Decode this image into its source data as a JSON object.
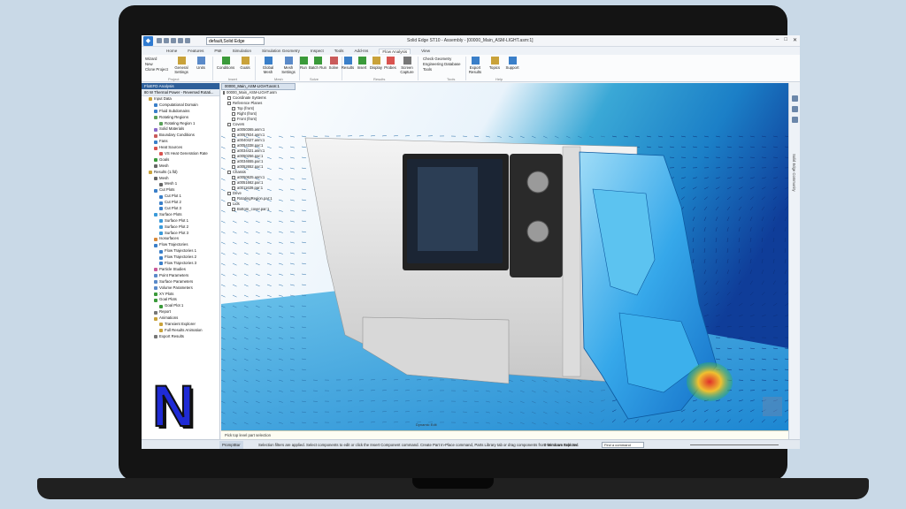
{
  "titlebar": {
    "environment": "default,Solid Edge",
    "window_title": "Solid Edge ST10 - Assembly - [00000_Main_ASM-LIGHT.asm:1]"
  },
  "tabs": [
    "Home",
    "Features",
    "PMI",
    "Simulation",
    "Simulation Geometry",
    "Inspect",
    "Tools",
    "Add-Ins",
    "Flow Analysis",
    "View"
  ],
  "ribbon": {
    "project": {
      "wizard": "Wizard",
      "new": "New",
      "clone": "Clone Project",
      "general": "General Settings",
      "units": "Units",
      "group": "Project"
    },
    "insert": {
      "conditions": "Conditions",
      "goals": "Goals",
      "group": "Insert"
    },
    "mesh": {
      "global": "Global Mesh",
      "settings": "Mesh Settings",
      "group": "Mesh"
    },
    "solve": {
      "run": "Run",
      "batch": "Batch Run",
      "solve": "Solve",
      "group": "Solve"
    },
    "results": {
      "results": "Results",
      "insert": "Insert",
      "display": "Display",
      "probes": "Probes",
      "capture": "Screen Capture",
      "group": "Results"
    },
    "tools": {
      "check": "Check Geometry",
      "db": "Engineering Database",
      "tools": "Tools",
      "group": "Tools"
    },
    "export": {
      "export": "Export Results",
      "topics": "Topics",
      "support": "Support",
      "group": "Help"
    }
  },
  "left_panel": {
    "header": "FloEFD Analysis",
    "project": "80 W Thermal Power - Reversed Rotati...",
    "tree": [
      {
        "label": "Input Data",
        "indent": 1,
        "color": "#c9a23a"
      },
      {
        "label": "Computational Domain",
        "indent": 2,
        "color": "#3a7fc9"
      },
      {
        "label": "Fluid Subdomains",
        "indent": 2,
        "color": "#3a7fc9"
      },
      {
        "label": "Rotating Regions",
        "indent": 2,
        "color": "#5aa05a"
      },
      {
        "label": "Rotating Region 1",
        "indent": 3,
        "color": "#5aa05a"
      },
      {
        "label": "Solid Materials",
        "indent": 2,
        "color": "#8a6ac9"
      },
      {
        "label": "Boundary Conditions",
        "indent": 2,
        "color": "#c95a5a"
      },
      {
        "label": "Fans",
        "indent": 2,
        "color": "#3a7fc9"
      },
      {
        "label": "Heat Sources",
        "indent": 2,
        "color": "#d9534f"
      },
      {
        "label": "VS Heat Generation Rate",
        "indent": 3,
        "color": "#d9534f"
      },
      {
        "label": "Goals",
        "indent": 2,
        "color": "#3a9a3a"
      },
      {
        "label": "Mesh",
        "indent": 2,
        "color": "#666666"
      },
      {
        "label": "Results (1.fld)",
        "indent": 1,
        "color": "#c9a23a"
      },
      {
        "label": "Mesh",
        "indent": 2,
        "color": "#666666"
      },
      {
        "label": "Mesh 1",
        "indent": 3,
        "color": "#666666"
      },
      {
        "label": "Cut Plots",
        "indent": 2,
        "color": "#3a7fc9"
      },
      {
        "label": "Cut Plot 1",
        "indent": 3,
        "color": "#3a7fc9"
      },
      {
        "label": "Cut Plot 2",
        "indent": 3,
        "color": "#3a7fc9"
      },
      {
        "label": "Cut Plot 3",
        "indent": 3,
        "color": "#3a7fc9"
      },
      {
        "label": "Surface Plots",
        "indent": 2,
        "color": "#3a9ad9"
      },
      {
        "label": "Surface Plot 1",
        "indent": 3,
        "color": "#3a9ad9"
      },
      {
        "label": "Surface Plot 2",
        "indent": 3,
        "color": "#3a9ad9"
      },
      {
        "label": "Surface Plot 3",
        "indent": 3,
        "color": "#3a9ad9"
      },
      {
        "label": "Isosurfaces",
        "indent": 2,
        "color": "#d98a3a"
      },
      {
        "label": "Flow Trajectories",
        "indent": 2,
        "color": "#3a7fc9"
      },
      {
        "label": "Flow Trajectories 1",
        "indent": 3,
        "color": "#3a7fc9"
      },
      {
        "label": "Flow Trajectories 2",
        "indent": 3,
        "color": "#3a7fc9"
      },
      {
        "label": "Flow Trajectories 3",
        "indent": 3,
        "color": "#3a7fc9"
      },
      {
        "label": "Particle Studies",
        "indent": 2,
        "color": "#c95a9a"
      },
      {
        "label": "Point Parameters",
        "indent": 2,
        "color": "#5a8ac9"
      },
      {
        "label": "Surface Parameters",
        "indent": 2,
        "color": "#5a8ac9"
      },
      {
        "label": "Volume Parameters",
        "indent": 2,
        "color": "#5a8ac9"
      },
      {
        "label": "XY Plots",
        "indent": 2,
        "color": "#3a9a3a"
      },
      {
        "label": "Goal Plots",
        "indent": 2,
        "color": "#3a9a3a"
      },
      {
        "label": "Goal Plot 1",
        "indent": 3,
        "color": "#3a9a3a"
      },
      {
        "label": "Report",
        "indent": 2,
        "color": "#777777"
      },
      {
        "label": "Animations",
        "indent": 2,
        "color": "#c9a23a"
      },
      {
        "label": "Transient Explorer",
        "indent": 3,
        "color": "#c9a23a"
      },
      {
        "label": "Full Results Animation",
        "indent": 3,
        "color": "#c9a23a"
      },
      {
        "label": "Export Results",
        "indent": 2,
        "color": "#777777"
      }
    ]
  },
  "viewport": {
    "tab": "00000_Main_ASM-LIGHT.asm:1",
    "pathfinder": [
      {
        "label": "00000_Main_ASM-LIGHT.asm",
        "indent": 0
      },
      {
        "label": "Coordinate Systems",
        "indent": 1
      },
      {
        "label": "Reference Planes",
        "indent": 1
      },
      {
        "label": "Top (front)",
        "indent": 2
      },
      {
        "label": "Right (front)",
        "indent": 2
      },
      {
        "label": "Front (front)",
        "indent": 2
      },
      {
        "label": "Covers",
        "indent": 1
      },
      {
        "label": "a0050365.asm:1",
        "indent": 2
      },
      {
        "label": "a0057924.asm:1",
        "indent": 2
      },
      {
        "label": "a0040427.asm:1",
        "indent": 2
      },
      {
        "label": "a0054338.par:1",
        "indent": 2
      },
      {
        "label": "a0034421.asm:1",
        "indent": 2
      },
      {
        "label": "a0050256.par:1",
        "indent": 2
      },
      {
        "label": "a0034655.par:1",
        "indent": 2
      },
      {
        "label": "a0052652.par:1",
        "indent": 2
      },
      {
        "label": "Chassis",
        "indent": 1
      },
      {
        "label": "a0050625.asm:1",
        "indent": 2
      },
      {
        "label": "a0051662.par:1",
        "indent": 2
      },
      {
        "label": "a0011639.par:1",
        "indent": 2
      },
      {
        "label": "Drive",
        "indent": 1
      },
      {
        "label": "RotatingRegion.par:1",
        "indent": 2
      },
      {
        "label": "Lids",
        "indent": 1
      },
      {
        "label": "Bottom_cover.par:1",
        "indent": 2
      }
    ],
    "tooltip": "Dynamic Edit"
  },
  "right_strip": {
    "label": "Solid Edge Community"
  },
  "prompt": "Pick top level part selection",
  "statusbar": {
    "tag": "PromptBar",
    "message": "Selection filters are applied. Select components to edit or click the Insert Component command. Create Part In-Place command, Parts Library tab or drag components from Windows Explorer.",
    "selected": "0 items are selected",
    "find": "Find a command"
  },
  "brand": {
    "letter": "N",
    "fill": "#1f2bd6",
    "shadow": "#111111"
  },
  "colors": {
    "accent": "#2d5f9a",
    "flow_blue": "#1f8fe0",
    "hot": "#e0302a"
  }
}
